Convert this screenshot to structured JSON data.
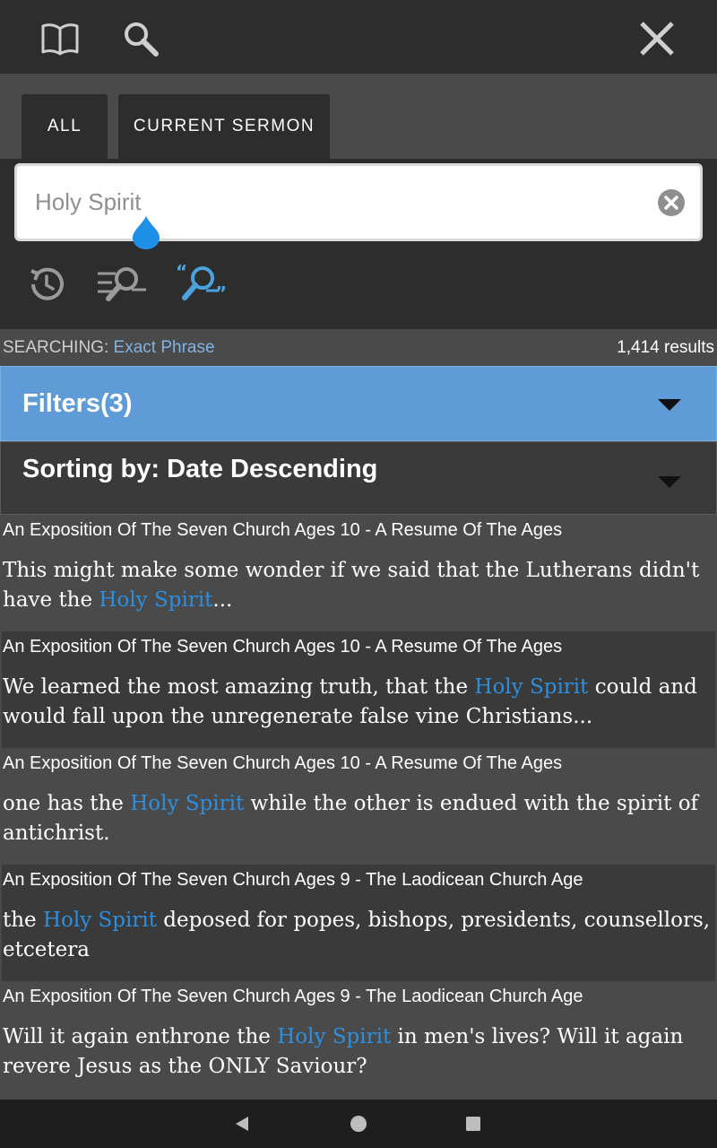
{
  "toolbar": {
    "book_icon": "book-icon",
    "search_icon": "search-icon",
    "close_icon": "close-icon"
  },
  "tabs": [
    {
      "label": "ALL",
      "active": true
    },
    {
      "label": "CURRENT SERMON",
      "active": false
    }
  ],
  "search": {
    "value": "Holy Spirit",
    "clear_icon": "clear-circle-icon"
  },
  "tools": [
    {
      "icon": "history-icon"
    },
    {
      "icon": "all-words-search-icon"
    },
    {
      "icon": "exact-phrase-search-icon",
      "active": true
    }
  ],
  "status": {
    "label": "SEARCHING:",
    "mode": "Exact Phrase",
    "count": "1,414 results"
  },
  "filters": {
    "label": "Filters(3)"
  },
  "sorting": {
    "label": "Sorting by: Date Descending"
  },
  "results": [
    {
      "title": "An Exposition Of The Seven Church Ages 10 - A Resume Of The Ages",
      "before": "This might make some wonder if we said that the Lutherans didn't have the ",
      "match": "Holy Spirit",
      "after": "..."
    },
    {
      "title": "An Exposition Of The Seven Church Ages 10 - A Resume Of The Ages",
      "before": "We learned the most amazing truth, that the ",
      "match": "Holy Spirit",
      "after": " could and would fall upon the unregenerate false vine Christians..."
    },
    {
      "title": "An Exposition Of The Seven Church Ages 10 - A Resume Of The Ages",
      "before": "one has the ",
      "match": "Holy Spirit",
      "after": " while the other is endued with the spirit of antichrist."
    },
    {
      "title": "An Exposition Of The Seven Church Ages 9 - The Laodicean Church Age",
      "before": "the ",
      "match": "Holy Spirit",
      "after": " deposed for popes, bishops, presidents, counsellors, etcetera"
    },
    {
      "title": "An Exposition Of The Seven Church Ages 9 - The Laodicean Church Age",
      "before": "Will it again enthrone the ",
      "match": "Holy Spirit",
      "after": " in men's lives? Will it again revere Jesus as the ONLY Saviour?"
    }
  ],
  "colors": {
    "highlight": "#2d8fe0",
    "filters_bar": "#5f9bd6",
    "accent_tool": "#4aa3df"
  },
  "navbar": {
    "back_icon": "nav-back-icon",
    "home_icon": "nav-home-icon",
    "recent_icon": "nav-recent-icon"
  }
}
